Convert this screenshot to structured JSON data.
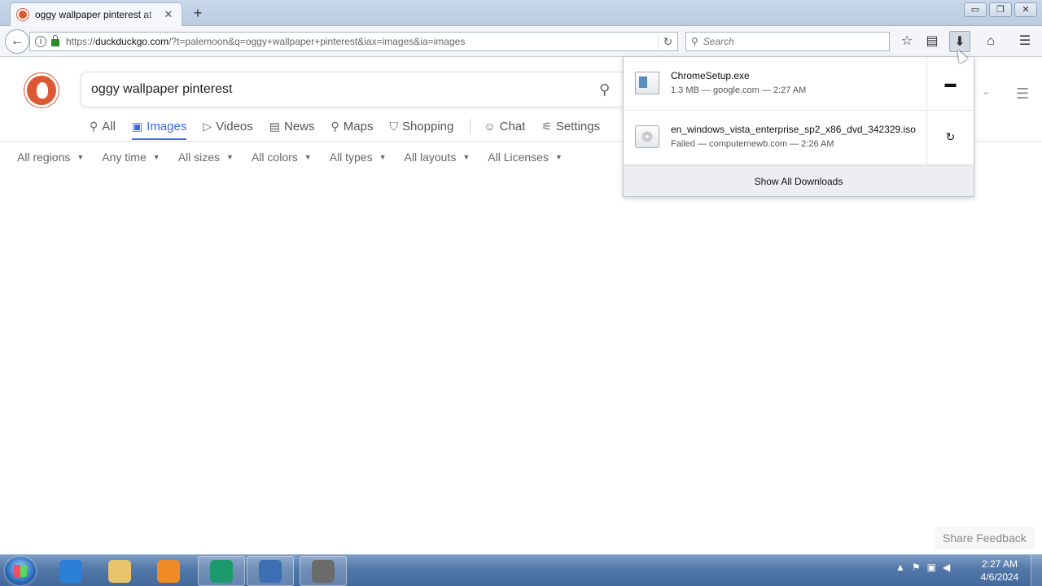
{
  "browser": {
    "tab": {
      "title": "oggy wallpaper pinterest at",
      "close": "✕"
    },
    "new_tab": "+",
    "window_buttons": {
      "minimize": "▭",
      "restore": "❐",
      "close": "✕"
    },
    "url": {
      "scheme": "https://",
      "host": "duckduckgo.com",
      "path": "/?t=palemoon&q=oggy+wallpaper+pinterest&iax=images&ia=images"
    },
    "search_placeholder": "Search"
  },
  "ddg": {
    "query": "oggy wallpaper pinterest",
    "tabs": [
      {
        "label": "All",
        "icon": "search-icon",
        "glyph": "⚲"
      },
      {
        "label": "Images",
        "icon": "image-icon",
        "glyph": "▣",
        "active": true
      },
      {
        "label": "Videos",
        "icon": "play-icon",
        "glyph": "▷"
      },
      {
        "label": "News",
        "icon": "news-icon",
        "glyph": "▤"
      },
      {
        "label": "Maps",
        "icon": "pin-icon",
        "glyph": "⚲"
      },
      {
        "label": "Shopping",
        "icon": "bag-icon",
        "glyph": "⛉"
      }
    ],
    "chat": {
      "label": "Chat",
      "glyph": "☺"
    },
    "settings": {
      "label": "Settings",
      "glyph": "⚟"
    },
    "filters": [
      "All regions",
      "Any time",
      "All sizes",
      "All colors",
      "All types",
      "All layouts",
      "All Licenses"
    ],
    "share_feedback": "Share Feedback"
  },
  "downloads": {
    "items": [
      {
        "name": "ChromeSetup.exe",
        "status": "1.3 MB — google.com — 2:27 AM",
        "action": "open-folder-icon",
        "action_glyph": "▬",
        "file_icon": "exe-file-icon"
      },
      {
        "name": "en_windows_vista_enterprise_sp2_x86_dvd_342329.iso",
        "status": "Failed — computernewb.com — 2:26 AM",
        "action": "retry-icon",
        "action_glyph": "↻",
        "file_icon": "iso-file-icon"
      }
    ],
    "show_all": "Show All Downloads"
  },
  "taskbar": {
    "apps": [
      {
        "name": "internet-explorer-icon",
        "color": "#2b7fd6",
        "open": false
      },
      {
        "name": "file-explorer-icon",
        "color": "#e9c46a",
        "open": false
      },
      {
        "name": "media-player-icon",
        "color": "#f08a24",
        "open": false
      },
      {
        "name": "pale-moon-icon",
        "color": "#1c9a6c",
        "open": true
      },
      {
        "name": "virtualbox-icon",
        "color": "#3d6fb5",
        "open": true
      },
      {
        "name": "app-icon",
        "color": "#6b6b6b",
        "open": true
      }
    ],
    "clock": {
      "time": "2:27 AM",
      "date": "4/6/2024"
    }
  },
  "colors": {
    "ddg_accent": "#3969ef",
    "ddg_brand": "#de5833"
  }
}
